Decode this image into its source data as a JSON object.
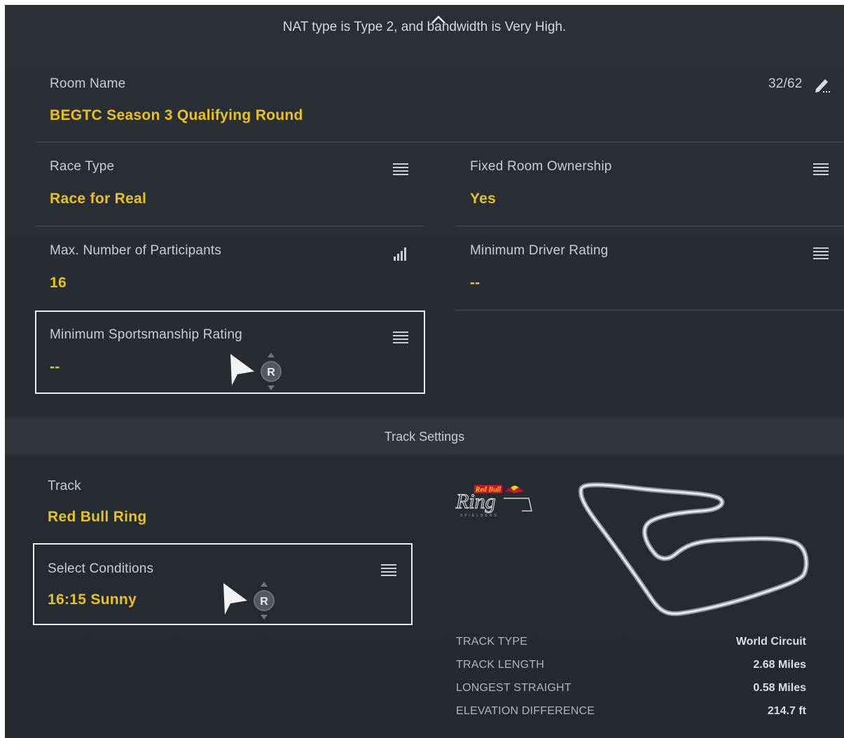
{
  "header": {
    "nat_status": "NAT type is Type 2, and bandwidth is Very High."
  },
  "room": {
    "label": "Room Name",
    "value": "BEGTC Season 3 Qualifying Round",
    "char_count": "32/62"
  },
  "settings": {
    "race_type": {
      "label": "Race Type",
      "value": "Race for Real"
    },
    "fixed_room_ownership": {
      "label": "Fixed Room Ownership",
      "value": "Yes"
    },
    "max_participants": {
      "label": "Max. Number of Participants",
      "value": "16"
    },
    "min_driver_rating": {
      "label": "Minimum Driver Rating",
      "value": "--"
    },
    "min_sportsmanship_rating": {
      "label": "Minimum Sportsmanship Rating",
      "value": "--"
    }
  },
  "track_settings": {
    "section_title": "Track Settings",
    "track": {
      "label": "Track",
      "value": "Red Bull Ring"
    },
    "conditions": {
      "label": "Select Conditions",
      "value": "16:15 Sunny"
    },
    "specs": [
      {
        "label": "TRACK TYPE",
        "value": "World Circuit"
      },
      {
        "label": "TRACK LENGTH",
        "value": "2.68 Miles"
      },
      {
        "label": "LONGEST STRAIGHT",
        "value": "0.58 Miles"
      },
      {
        "label": "ELEVATION DIFFERENCE",
        "value": "214.7 ft"
      }
    ],
    "logo": {
      "top_text": "Red Bull",
      "main_text": "Ring",
      "sub_text": "SPIELBERG"
    }
  },
  "controller_hint": {
    "button": "R"
  },
  "icons": {
    "collapse": "chevron-up-icon",
    "edit": "pencil-icon",
    "list": "list-menu-icon",
    "slider": "signal-bars-icon",
    "pointer": "pointer-cursor-icon"
  },
  "colors": {
    "accent": "#e8c21e",
    "background": "#272d33",
    "section_bar": "#30363c"
  }
}
